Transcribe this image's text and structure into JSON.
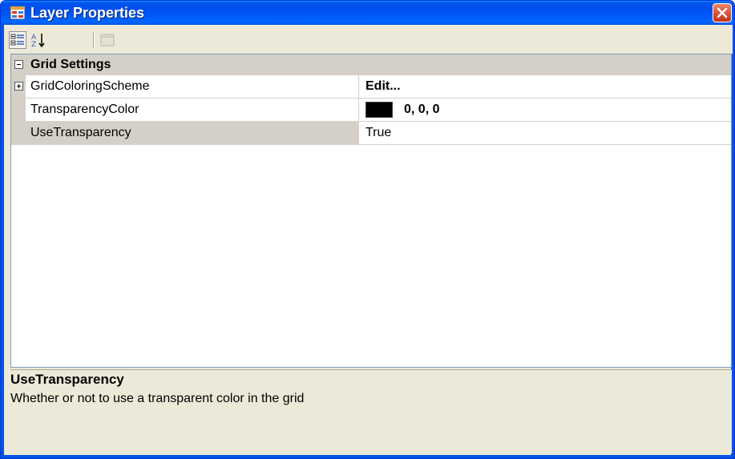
{
  "window": {
    "title": "Layer Properties"
  },
  "toolbar": {
    "buttons": [
      {
        "icon": "categorized-icon",
        "pressed": true
      },
      {
        "icon": "alphabetical-icon",
        "pressed": false
      },
      {
        "icon": "property-pages-icon",
        "pressed": false,
        "disabled": true
      }
    ]
  },
  "grid": {
    "category": {
      "label": "Grid Settings",
      "expanded": true
    },
    "properties": [
      {
        "name": "GridColoringScheme",
        "value": "Edit...",
        "expandable": true
      },
      {
        "name": "TransparencyColor",
        "value": "0, 0, 0",
        "swatch_color": "#000000"
      },
      {
        "name": "UseTransparency",
        "value": "True",
        "selected": true
      }
    ]
  },
  "description": {
    "title": "UseTransparency",
    "text": "Whether or not to use a transparent color in the grid"
  },
  "colors": {
    "title_bar": "#0055e5",
    "window_face": "#ece9d8",
    "category_bg": "#d4d0c8",
    "close_button": "#d9553a"
  }
}
